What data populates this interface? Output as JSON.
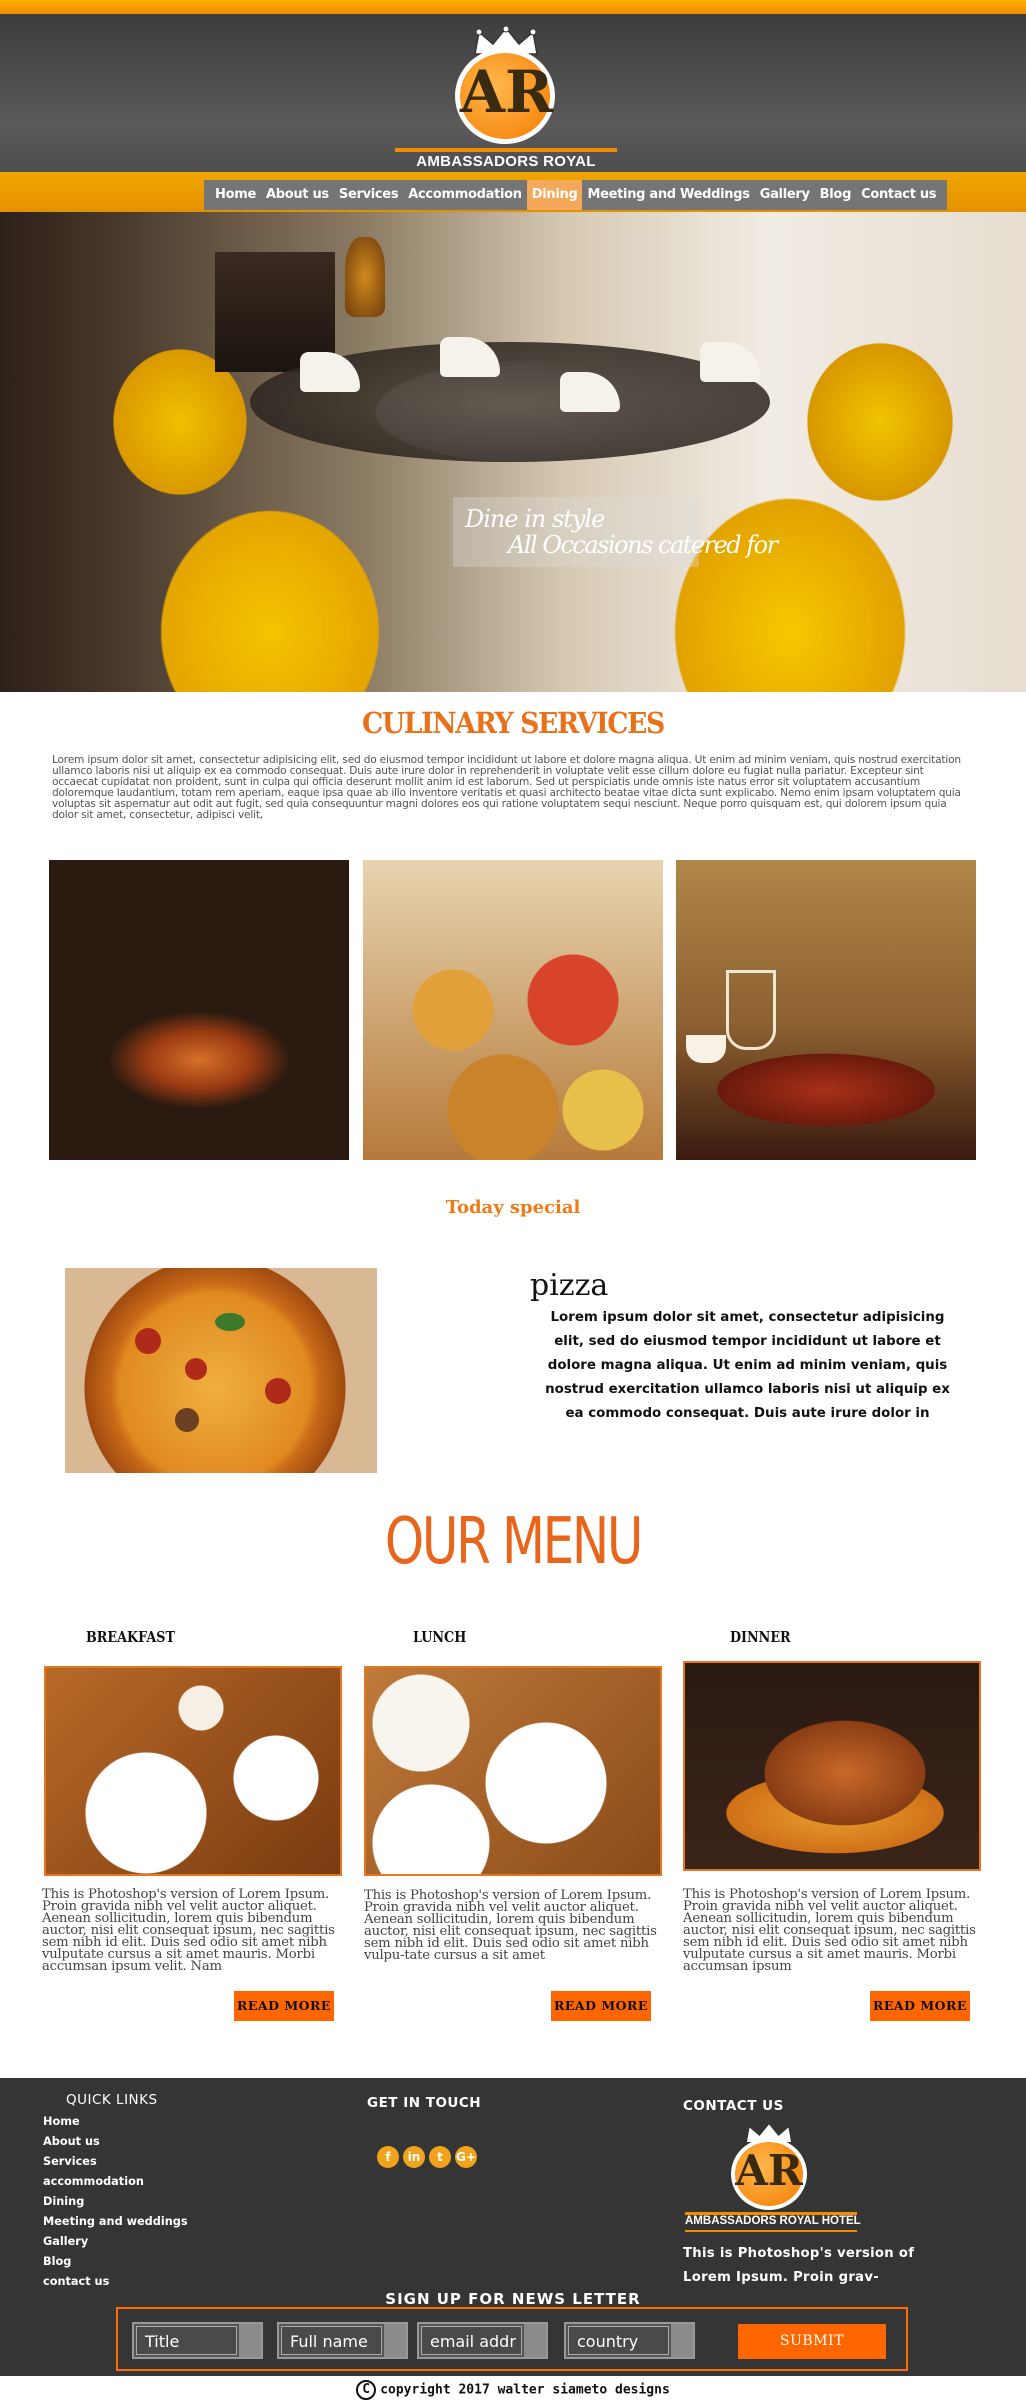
{
  "brand": {
    "logo_letters": "AR",
    "name": "AMBASSADORS ROYAL HOTEL",
    "accent": "#f07a18",
    "nav_band_color": "#e9a000"
  },
  "nav": {
    "items": [
      "Home",
      "About us",
      "Services",
      "Accommodation",
      "Dining",
      "Meeting and Weddings",
      "Gallery",
      "Blog",
      "Contact us"
    ],
    "active": "Dining"
  },
  "hero": {
    "caption_line1": "Dine in style",
    "caption_line2": "All Occasions catered for"
  },
  "culinary": {
    "title": "CULINARY SERVICES",
    "text": "Lorem ipsum dolor sit amet, consectetur adipisicing elit, sed do eiusmod tempor incididunt ut labore et dolore magna aliqua. Ut enim ad minim veniam, quis nostrud exercitation ullamco laboris nisi ut aliquip ex ea commodo consequat. Duis aute irure dolor in reprehenderit in voluptate velit esse cillum dolore eu fugiat nulla pariatur. Excepteur sint occaecat cupidatat non proident, sunt in culpa qui officia deserunt mollit anim id est laborum. Sed ut perspiciatis unde omnis iste natus error sit voluptatem accusantium doloremque laudantium, totam rem aperiam, eaque ipsa quae ab illo inventore veritatis et quasi architecto beatae vitae dicta sunt explicabo. Nemo enim ipsam voluptatem quia voluptas sit aspernatur aut odit aut fugit, sed quia consequuntur magni dolores eos qui ratione voluptatem sequi nesciunt. Neque porro quisquam est, qui dolorem ipsum quia dolor sit amet, consectetur, adipisci velit,"
  },
  "today_special": {
    "title": "Today special",
    "dish": "pizza",
    "text": "Lorem ipsum dolor sit amet, consectetur adipisicing elit, sed do eiusmod tempor incididunt ut labore et dolore magna aliqua. Ut enim ad minim veniam, quis nostrud exercitation ullamco laboris nisi ut aliquip ex ea commodo consequat. Duis aute irure dolor in"
  },
  "menu": {
    "title": "OUR MENU",
    "read_more": "READ MORE",
    "meals": [
      {
        "label": "BREAKFAST",
        "text": "This is Photoshop's version  of Lorem Ipsum. Proin gravida nibh vel velit auctor aliquet. Aenean sollicitudin, lorem quis bibendum auctor, nisi elit consequat ipsum, nec sagittis sem nibh id elit. Duis sed odio sit amet nibh vulputate cursus a sit amet mauris. Morbi accumsan ipsum velit. Nam"
      },
      {
        "label": "LUNCH",
        "text": "This is Photoshop's version  of Lorem Ipsum. Proin gravida nibh vel velit auctor aliquet. Aenean sollicitudin, lorem quis bibendum auctor, nisi elit consequat ipsum, nec sagittis sem nibh id elit. Duis sed odio sit amet nibh vulpu-tate cursus a sit amet"
      },
      {
        "label": "DINNER",
        "text": "This is Photoshop's version  of Lorem Ipsum. Proin gravida nibh vel velit auctor aliquet. Aenean sollicitudin, lorem quis bibendum auctor, nisi elit consequat ipsum, nec sagittis sem nibh id elit. Duis sed odio sit amet nibh vulputate cursus a sit amet mauris. Morbi accumsan ipsum"
      }
    ]
  },
  "footer": {
    "quick_links_title": "QUICK LINKS",
    "quick_links": [
      "Home",
      "About us",
      "Services",
      "accommodation",
      "Dining",
      "Meeting and weddings",
      "Gallery",
      "Blog",
      "contact us"
    ],
    "get_in_touch_title": "GET IN TOUCH",
    "social": [
      {
        "icon": "facebook-icon",
        "glyph": "f"
      },
      {
        "icon": "linkedin-icon",
        "glyph": "in"
      },
      {
        "icon": "twitter-icon",
        "glyph": "t"
      },
      {
        "icon": "google-plus-icon",
        "glyph": "G+"
      }
    ],
    "contact_title": "CONTACT US",
    "contact_text": "This is Photoshop's version of Lorem Ipsum. Proin grav-",
    "signup_title": "SIGN UP FOR NEWS LETTER",
    "fields": {
      "title": "Title",
      "full_name": "Full name",
      "email": "email addr",
      "country": "country"
    },
    "submit": "SUBMIT",
    "copyright": "copyright 2017  walter siameto designs",
    "copyright_symbol": "C"
  }
}
